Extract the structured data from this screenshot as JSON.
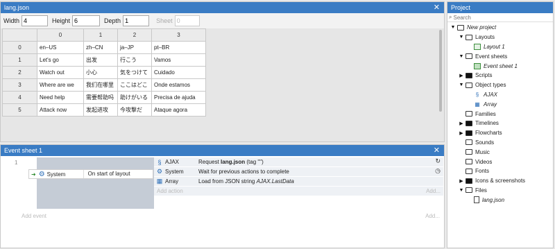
{
  "array_editor": {
    "title": "lang.json",
    "width_label": "Width",
    "width_value": "4",
    "height_label": "Height",
    "height_value": "6",
    "depth_label": "Depth",
    "depth_value": "1",
    "sheet_label": "Sheet",
    "sheet_value": "0",
    "columns": [
      "0",
      "1",
      "2",
      "3"
    ],
    "rows": [
      {
        "index": "0",
        "cells": [
          "en–US",
          "zh–CN",
          "ja–JP",
          "pt–BR"
        ]
      },
      {
        "index": "1",
        "cells": [
          "Let's go",
          "出发",
          "行こう",
          "Vamos"
        ]
      },
      {
        "index": "2",
        "cells": [
          "Watch out",
          "小心",
          "気をつけて",
          "Cuidado"
        ]
      },
      {
        "index": "3",
        "cells": [
          "Where are we",
          "我们在哪里",
          "ここはどこ",
          "Onde estamos"
        ]
      },
      {
        "index": "4",
        "cells": [
          "Need help",
          "需要帮助吗",
          "助けがいる",
          "Precisa de ajuda"
        ]
      },
      {
        "index": "5",
        "cells": [
          "Attack now",
          "发起进攻",
          "今攻撃だ",
          "Ataque agora"
        ]
      }
    ]
  },
  "event_sheet": {
    "title": "Event sheet 1",
    "event_number": "1",
    "condition": {
      "object": "System",
      "text": "On start of layout"
    },
    "actions": [
      {
        "object": "AJAX",
        "icon": "ajax-icon",
        "pre": "Request ",
        "bold": "lang.json",
        "post": " (tag \"\")",
        "right_icon": "reload-icon"
      },
      {
        "object": "System",
        "icon": "gear-icon",
        "text": "Wait for previous actions to complete",
        "right_icon": "clock-icon"
      },
      {
        "object": "Array",
        "icon": "array-icon",
        "pre": "Load from JSON string ",
        "italic": "AJAX.LastData"
      }
    ],
    "add_action": "Add action",
    "add_ellipsis": "Add...",
    "add_event": "Add event"
  },
  "project": {
    "title": "Project",
    "search_placeholder": "Search",
    "tree": [
      {
        "label": "New project",
        "level": 0,
        "toggle": "▼",
        "icon": "folder-outline",
        "italic": true
      },
      {
        "label": "Layouts",
        "level": 1,
        "toggle": "▼",
        "icon": "folder-outline"
      },
      {
        "label": "Layout 1",
        "level": 2,
        "toggle": "",
        "icon": "layout-icon",
        "italic": true
      },
      {
        "label": "Event sheets",
        "level": 1,
        "toggle": "▼",
        "icon": "folder-outline"
      },
      {
        "label": "Event sheet 1",
        "level": 2,
        "toggle": "",
        "icon": "event-sheet-icon",
        "italic": true
      },
      {
        "label": "Scripts",
        "level": 1,
        "toggle": "▶",
        "icon": "folder-filled"
      },
      {
        "label": "Object types",
        "level": 1,
        "toggle": "▼",
        "icon": "folder-outline"
      },
      {
        "label": "AJAX",
        "level": 2,
        "toggle": "",
        "icon": "ajax-icon",
        "italic": true
      },
      {
        "label": "Array",
        "level": 2,
        "toggle": "",
        "icon": "array-icon",
        "italic": true
      },
      {
        "label": "Families",
        "level": 1,
        "toggle": "",
        "icon": "folder-outline"
      },
      {
        "label": "Timelines",
        "level": 1,
        "toggle": "▶",
        "icon": "folder-filled"
      },
      {
        "label": "Flowcharts",
        "level": 1,
        "toggle": "▶",
        "icon": "folder-filled"
      },
      {
        "label": "Sounds",
        "level": 1,
        "toggle": "",
        "icon": "folder-outline"
      },
      {
        "label": "Music",
        "level": 1,
        "toggle": "",
        "icon": "folder-outline"
      },
      {
        "label": "Videos",
        "level": 1,
        "toggle": "",
        "icon": "folder-outline"
      },
      {
        "label": "Fonts",
        "level": 1,
        "toggle": "",
        "icon": "folder-outline"
      },
      {
        "label": "Icons & screenshots",
        "level": 1,
        "toggle": "▶",
        "icon": "folder-filled"
      },
      {
        "label": "Files",
        "level": 1,
        "toggle": "▼",
        "icon": "folder-outline"
      },
      {
        "label": "lang.json",
        "level": 2,
        "toggle": "",
        "icon": "file-icon",
        "italic": true
      }
    ]
  }
}
